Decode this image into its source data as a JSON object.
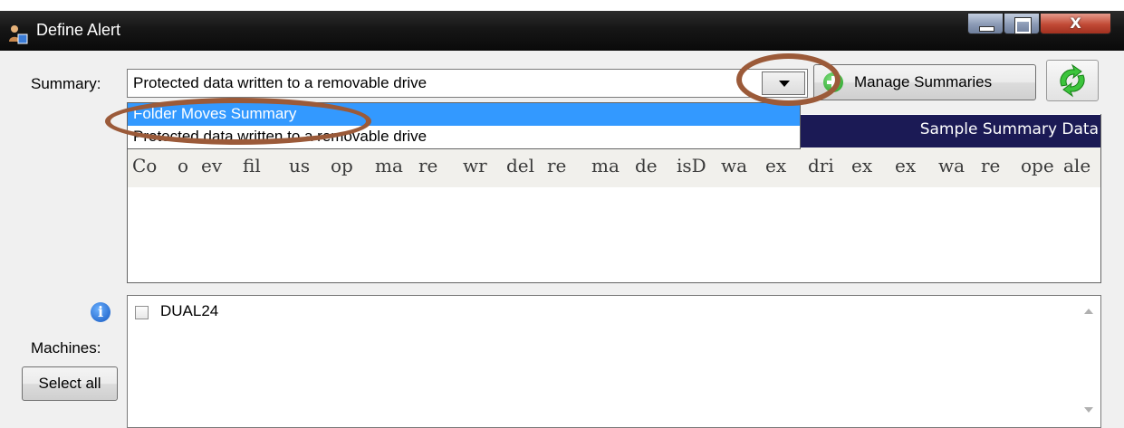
{
  "window": {
    "title": "Define Alert",
    "close_glyph": "X"
  },
  "summary": {
    "label": "Summary:",
    "selected_value": "Protected data written to a removable drive",
    "manage_button": "Manage Summaries",
    "options": [
      "Folder Moves Summary",
      "Protected data written to a removable drive"
    ],
    "highlighted_option": "Folder Moves Summary"
  },
  "sample_panel": {
    "title": "Sample Summary Data",
    "columns": [
      "Co",
      "o",
      "ev",
      "fil",
      "us",
      "op",
      "ma",
      "re",
      "wr",
      "del",
      "re",
      "ma",
      "de",
      "isD",
      "wa",
      "ex",
      "dri",
      "ex",
      "ex",
      "wa",
      "re",
      "ope",
      "ale"
    ]
  },
  "machines": {
    "label": "Machines:",
    "select_all_button": "Select all",
    "items": [
      {
        "name": "DUAL24",
        "checked": false
      }
    ]
  },
  "colors": {
    "selection": "#3399ff",
    "header_band": "#1b1a55",
    "annotation": "#9b5a39"
  },
  "icons": [
    "app-icon",
    "minimize-icon",
    "maximize-icon",
    "close-icon",
    "dropdown-arrow-icon",
    "add-icon",
    "refresh-icon",
    "info-icon",
    "scroll-up-icon",
    "scroll-down-icon"
  ]
}
